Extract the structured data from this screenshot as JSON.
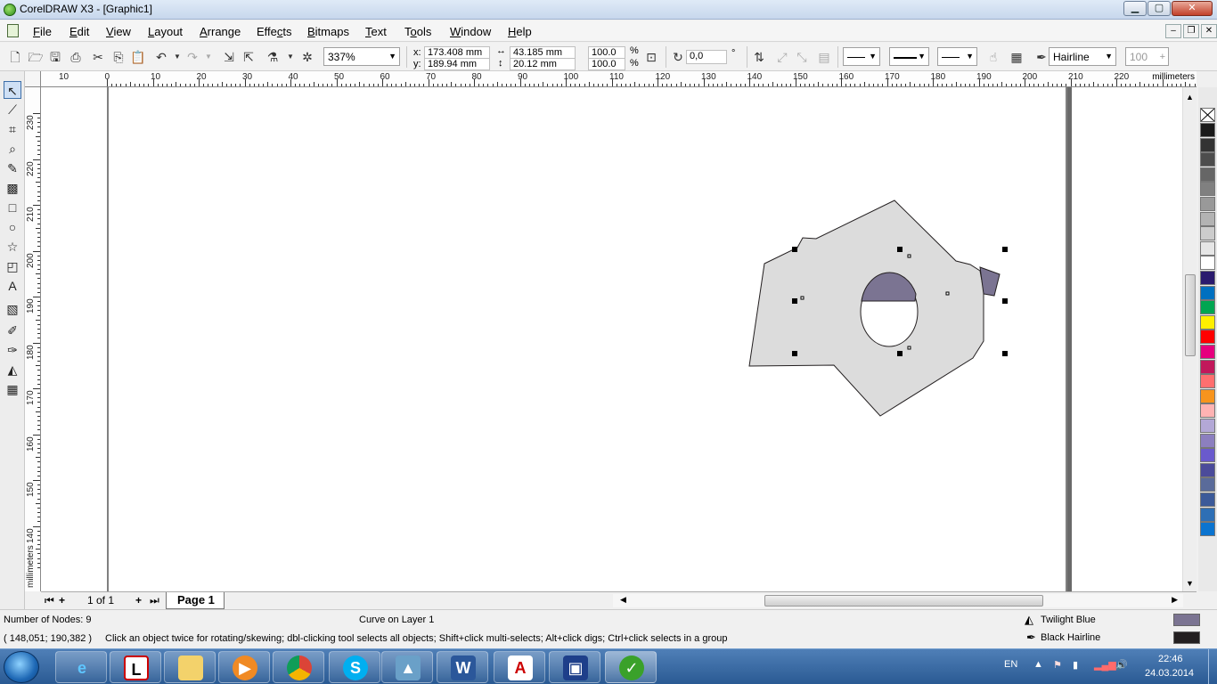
{
  "window": {
    "title": "CorelDRAW X3 - [Graphic1]"
  },
  "menu": [
    "File",
    "Edit",
    "View",
    "Layout",
    "Arrange",
    "Effects",
    "Bitmaps",
    "Text",
    "Tools",
    "Window",
    "Help"
  ],
  "menu_accel": [
    "F",
    "E",
    "V",
    "L",
    "A",
    "c",
    "B",
    "T",
    "o",
    "W",
    "H"
  ],
  "toolbar": {
    "zoom": "337%",
    "x_label": "x:",
    "x_value": "173.408 mm",
    "y_label": "y:",
    "y_value": "189.94 mm",
    "width_value": "43.185 mm",
    "height_value": "20.12 mm",
    "scale_x": "100.0",
    "scale_y": "100.0",
    "percent": "%",
    "rotation": "0,0",
    "degree": "°",
    "outline_width": "Hairline",
    "transparency": "100"
  },
  "ruler": {
    "units": "millimeters",
    "h_labels": [
      "10",
      "0",
      "10",
      "20",
      "30",
      "40",
      "50",
      "60",
      "70",
      "80",
      "90",
      "100",
      "110",
      "120",
      "130",
      "140",
      "150",
      "160",
      "170",
      "180",
      "190",
      "200",
      "210",
      "220"
    ],
    "v_labels": [
      "230",
      "220",
      "210",
      "200",
      "190",
      "180",
      "170",
      "160",
      "150",
      "140"
    ],
    "v_units": "millimeters"
  },
  "page_nav": {
    "counter": "1 of 1",
    "tab": "Page 1"
  },
  "status": {
    "nodes": "Number of Nodes: 9",
    "object": "Curve on Layer 1",
    "cursor": "( 148,051; 190,382 )",
    "hint": "Click an object twice for rotating/skewing; dbl-clicking tool selects all objects; Shift+click multi-selects; Alt+click digs; Ctrl+click selects in a group",
    "fill_name": "Twilight Blue",
    "outline_name": "Black  Hairline"
  },
  "colors": {
    "fill": "#7b7492",
    "shape": "#dcdcdc",
    "outline": "#231f20",
    "palette": [
      "#1a1a1a",
      "#333333",
      "#4d4d4d",
      "#666666",
      "#808080",
      "#999999",
      "#b3b3b3",
      "#cccccc",
      "#e6e6e6",
      "#ffffff",
      "#2a1a6e",
      "#0070c0",
      "#00a651",
      "#ffef00",
      "#ff0000",
      "#e6007e",
      "#c2185b",
      "#ff6f6f",
      "#f7941d",
      "#ffb3b3",
      "#b3a8d6",
      "#8c7fbf",
      "#6a5acd",
      "#4b4b9a",
      "#5a6b9a",
      "#3c5a99",
      "#2e6fb5",
      "#0b74d0"
    ]
  },
  "taskbar": {
    "lang": "EN",
    "time": "22:46",
    "date": "24.03.2014"
  }
}
